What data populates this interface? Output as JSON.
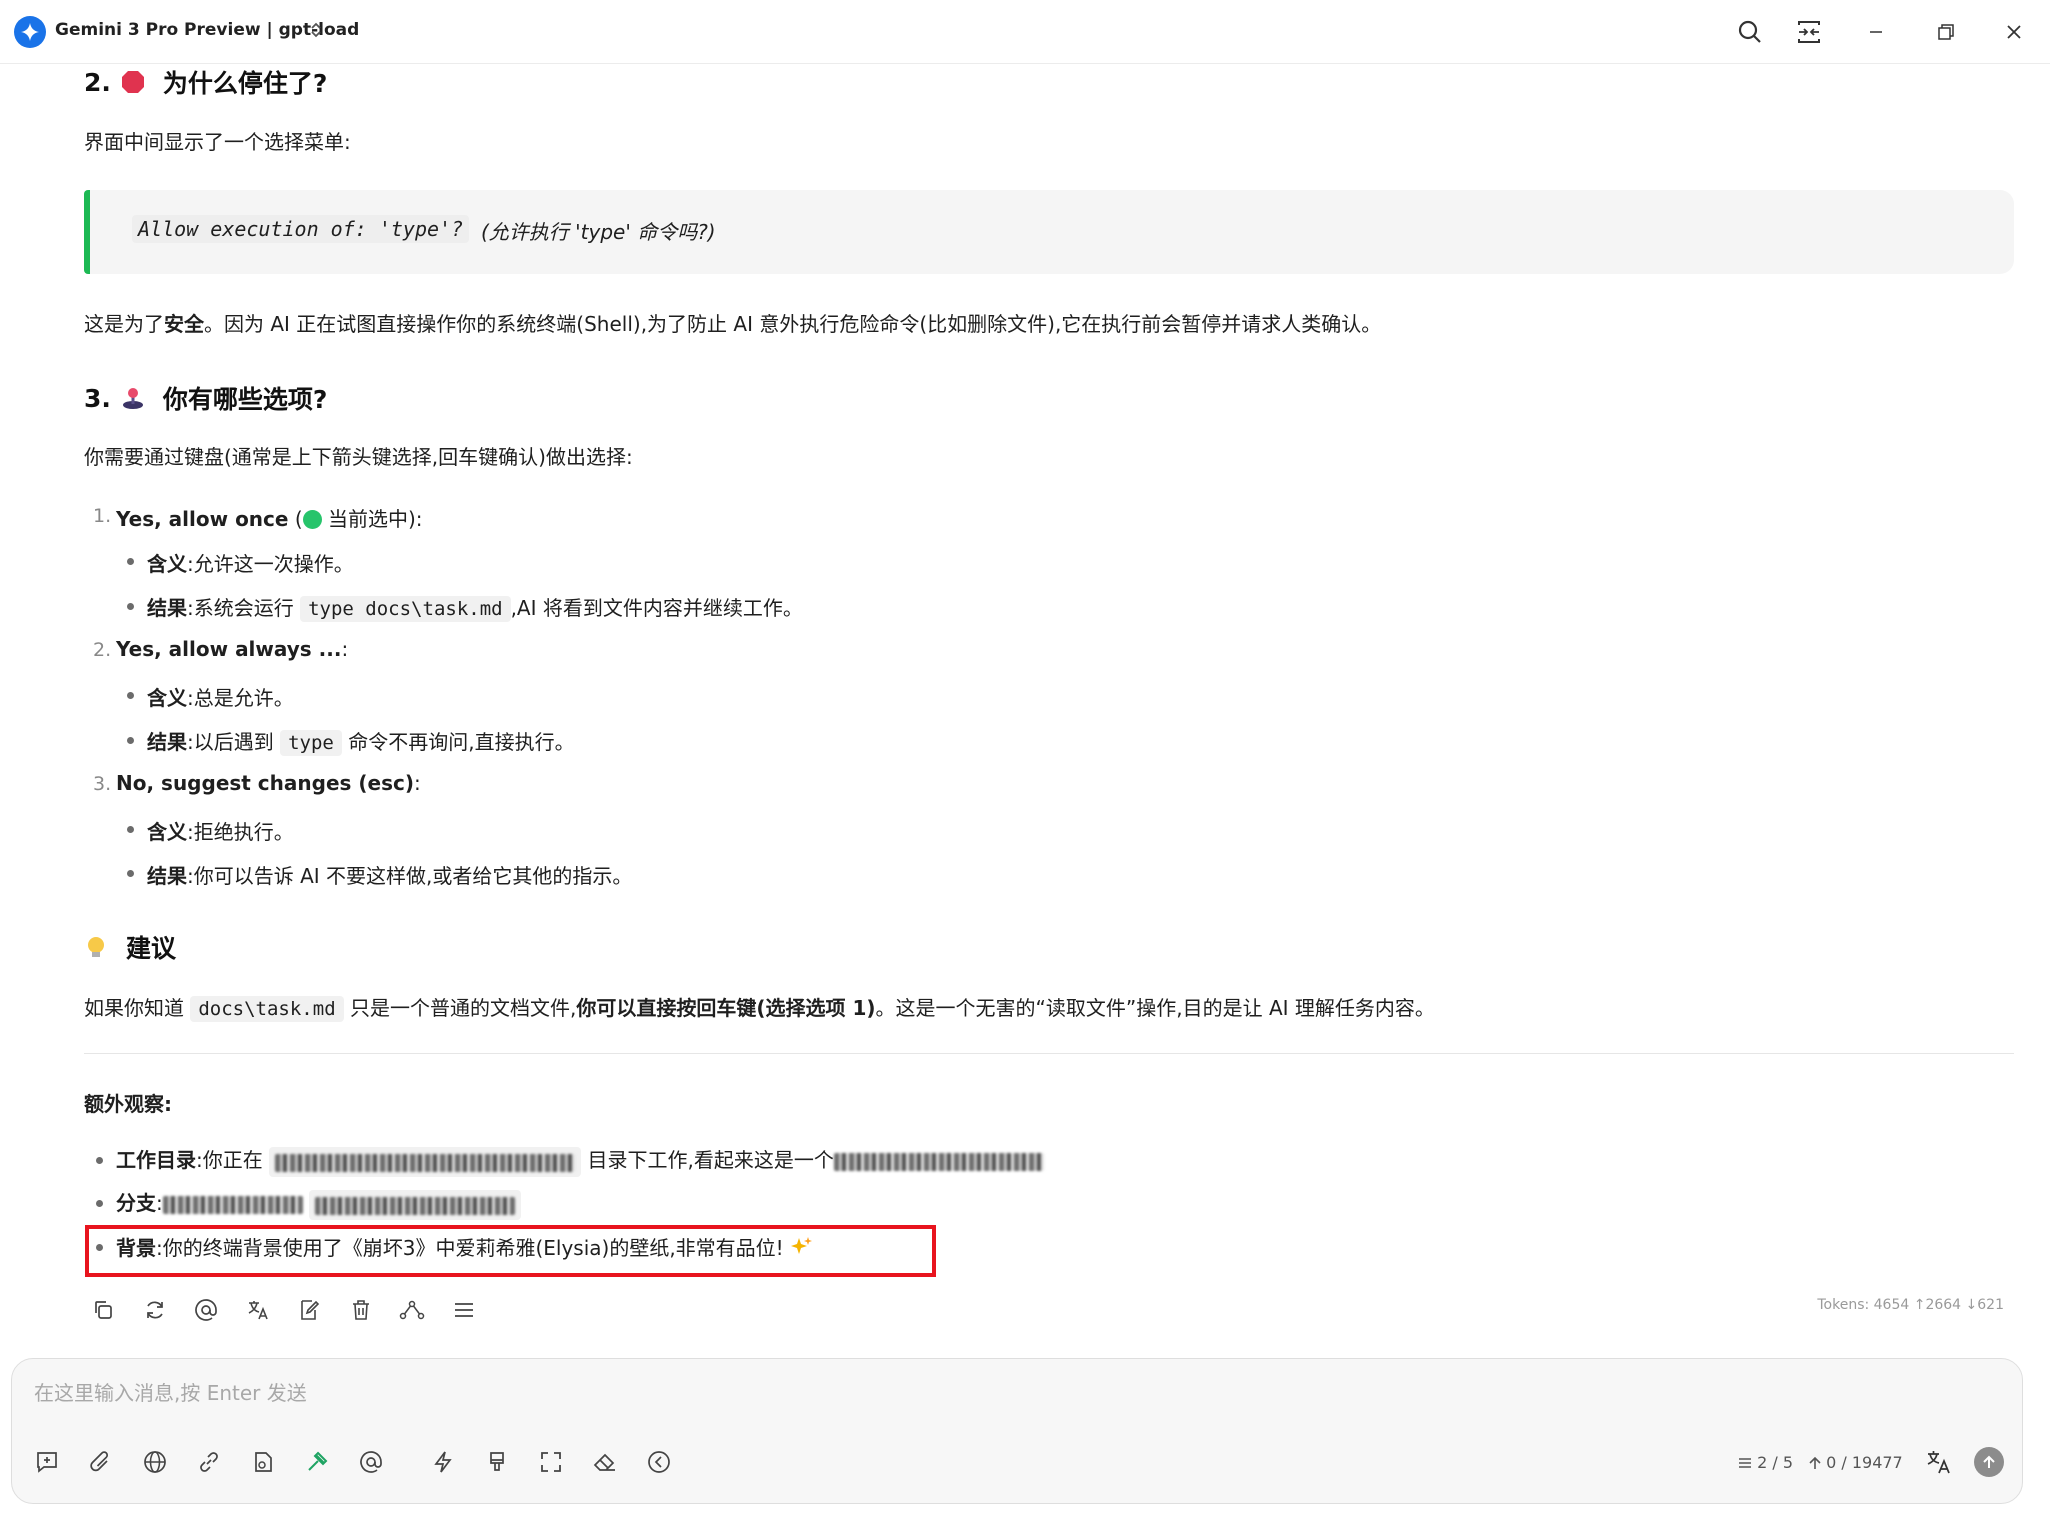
{
  "window": {
    "title": "Gemini 3 Pro Preview | gpt-load",
    "switch_glyph": "⌃⌄"
  },
  "section2": {
    "number": "2.",
    "title": "为什么停住了?",
    "intro": "界面中间显示了一个选择菜单:",
    "quote_code": "Allow execution of: 'type'?",
    "quote_text": "(允许执行 'type' 命令吗?)",
    "safety_pre": "这是为了",
    "safety_bold": "安全",
    "safety_post": "。因为 AI 正在试图直接操作你的系统终端(Shell),为了防止 AI 意外执行危险命令(比如删除文件),它在执行前会暂停并请求人类确认。"
  },
  "section3": {
    "number": "3.",
    "title": "你有哪些选项?",
    "intro": "你需要通过键盘(通常是上下箭头键选择,回车键确认)做出选择:",
    "options": [
      {
        "num": "1.",
        "title": "Yes, allow once",
        "suffix_pre": " (",
        "suffix_post": " 当前选中):",
        "meaning_label": "含义",
        "meaning": ":允许这一次操作。",
        "result_label": "结果",
        "result_pre": ":系统会运行 ",
        "result_code": "type docs\\task.md",
        "result_post": ",AI 将看到文件内容并继续工作。"
      },
      {
        "num": "2.",
        "title": "Yes, allow always ...",
        "suffix": ":",
        "meaning_label": "含义",
        "meaning": ":总是允许。",
        "result_label": "结果",
        "result_pre": ":以后遇到 ",
        "result_code": "type",
        "result_post": " 命令不再询问,直接执行。"
      },
      {
        "num": "3.",
        "title": "No, suggest changes (esc)",
        "suffix": ":",
        "meaning_label": "含义",
        "meaning": ":拒绝执行。",
        "result_label": "结果",
        "result_post": ":你可以告诉 AI 不要这样做,或者给它其他的指示。"
      }
    ]
  },
  "suggestion": {
    "title": "建议",
    "pre": "如果你知道 ",
    "code": "docs\\task.md",
    "mid": " 只是一个普通的文档文件,",
    "bold": "你可以直接按回车键(选择选项 1)",
    "post": "。这是一个无害的“读取文件”操作,目的是让 AI 理解任务内容。"
  },
  "extra": {
    "title": "额外观察:",
    "workdir_label": "工作目录",
    "workdir_pre": ":你正在 ",
    "workdir_mid": " 目录下工作,看起来这是一个",
    "branch_label": "分支",
    "branch_pre": ":",
    "bg_label": "背景",
    "bg_text": ":你的终端背景使用了《崩坏3》中爱莉希雅(Elysia)的壁纸,非常有品位!"
  },
  "tokens": "Tokens: 4654 ↑2664 ↓621",
  "input": {
    "placeholder": "在这里输入消息,按 Enter 发送",
    "context_count": "2 / 5",
    "token_count": "0 / 19477"
  },
  "colors": {
    "accent_green": "#1db954",
    "highlight_red": "#e8141e",
    "logo_blue": "#1a73e8"
  }
}
